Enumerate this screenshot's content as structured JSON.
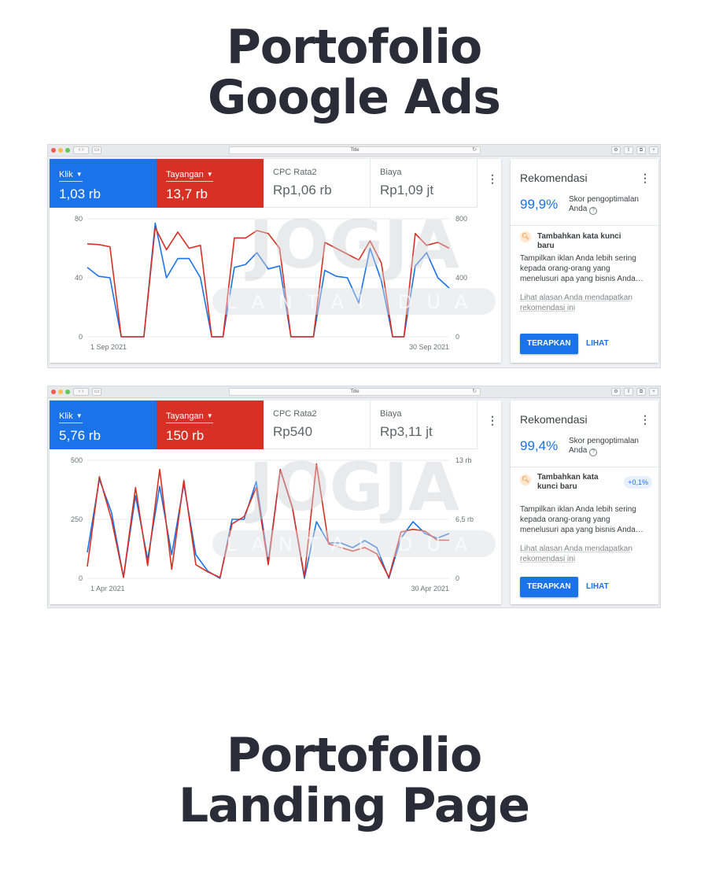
{
  "headings": {
    "top": [
      "Portofolio",
      "Google Ads"
    ],
    "bottom": [
      "Portofolio",
      "Landing Page"
    ]
  },
  "watermark": {
    "title": "JOGJA",
    "subtitle": "LANTAI DUA"
  },
  "colors": {
    "blue": "#1a73e8",
    "red": "#d93025",
    "heading": "#2a2d38"
  },
  "panels": [
    {
      "browser_title": "Title",
      "metrics": [
        {
          "label": "Klik",
          "value": "1,03 rb"
        },
        {
          "label": "Tayangan",
          "value": "13,7 rb"
        },
        {
          "label": "CPC Rata2",
          "value": "Rp1,06 rb"
        },
        {
          "label": "Biaya",
          "value": "Rp1,09 jt"
        }
      ],
      "reco": {
        "title": "Rekomendasi",
        "score": "99,9%",
        "score_label": "Skor pengoptimalan Anda",
        "suggestion_title": "Tambahkan kata kunci baru",
        "suggestion_badge": "",
        "suggestion_desc": "Tampilkan iklan Anda lebih sering kepada orang-orang yang menelusuri apa yang bisnis Anda…",
        "suggestion_why": "Lihat alasan Anda mendapatkan rekomendasi ini",
        "apply": "TERAPKAN",
        "view": "LIHAT"
      },
      "chart_data": {
        "type": "line",
        "x_start_label": "1 Sep 2021",
        "x_end_label": "30 Sep 2021",
        "left_ticks": [
          "0",
          "40",
          "80"
        ],
        "right_ticks": [
          "0",
          "400",
          "800"
        ],
        "ylim_left": [
          0,
          80
        ],
        "ylim_right": [
          0,
          800
        ],
        "series": [
          {
            "color": "#1a73e8",
            "axis": "left",
            "values": [
              47,
              41,
              40,
              0,
              0,
              0,
              77,
              40,
              53,
              53,
              40,
              0,
              0,
              47,
              49,
              57,
              46,
              48,
              0,
              0,
              0,
              45,
              41,
              40,
              23,
              60,
              38,
              0,
              0,
              48,
              57,
              40,
              33
            ]
          },
          {
            "color": "#d93025",
            "axis": "right",
            "values": [
              630,
              625,
              610,
              0,
              0,
              0,
              740,
              590,
              710,
              600,
              620,
              0,
              0,
              670,
              670,
              720,
              700,
              600,
              0,
              0,
              0,
              640,
              600,
              560,
              520,
              650,
              500,
              0,
              0,
              700,
              620,
              640,
              600
            ]
          }
        ]
      }
    },
    {
      "browser_title": "Title",
      "metrics": [
        {
          "label": "Klik",
          "value": "5,76 rb"
        },
        {
          "label": "Tayangan",
          "value": "150 rb"
        },
        {
          "label": "CPC Rata2",
          "value": "Rp540"
        },
        {
          "label": "Biaya",
          "value": "Rp3,11 jt"
        }
      ],
      "reco": {
        "title": "Rekomendasi",
        "score": "99,4%",
        "score_label": "Skor pengoptimalan Anda",
        "suggestion_title": "Tambahkan kata kunci baru",
        "suggestion_badge": "+0,1%",
        "suggestion_desc": "Tampilkan iklan Anda lebih sering kepada orang-orang yang menelusuri apa yang bisnis Anda…",
        "suggestion_why": "Lihat alasan Anda mendapatkan rekomendasi ini",
        "apply": "TERAPKAN",
        "view": "LIHAT"
      },
      "chart_data": {
        "type": "line",
        "x_start_label": "1 Apr 2021",
        "x_end_label": "30 Apr 2021",
        "left_ticks": [
          "0",
          "250",
          "500"
        ],
        "right_ticks": [
          "0",
          "6,5 rb",
          "13 rb"
        ],
        "ylim_left": [
          0,
          500
        ],
        "ylim_right": [
          0,
          13000
        ],
        "series": [
          {
            "color": "#1a73e8",
            "axis": "left",
            "values": [
              110,
              420,
              280,
              5,
              350,
              80,
              390,
              100,
              400,
              100,
              30,
              0,
              250,
              250,
              410,
              70,
              460,
              300,
              0,
              240,
              150,
              150,
              130,
              160,
              130,
              0,
              170,
              240,
              190,
              170,
              190
            ]
          },
          {
            "color": "#d93025",
            "axis": "right",
            "values": [
              1300,
              11200,
              6500,
              100,
              10000,
              1400,
              12000,
              1000,
              10800,
              1500,
              700,
              100,
              6000,
              6800,
              10000,
              1500,
              12000,
              7800,
              200,
              12600,
              3800,
              3400,
              3000,
              3400,
              2700,
              100,
              5100,
              5400,
              5200,
              4200,
              4200
            ]
          }
        ]
      }
    }
  ]
}
